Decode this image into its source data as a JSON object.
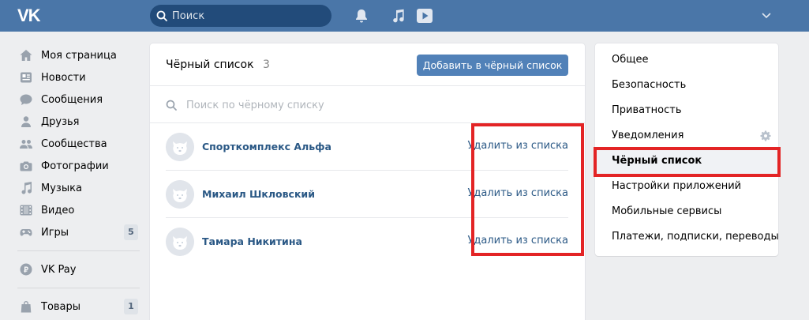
{
  "header": {
    "logo": "VK",
    "search_placeholder": "Поиск"
  },
  "left_menu": {
    "items": [
      {
        "label": "Моя страница",
        "icon": "home-icon"
      },
      {
        "label": "Новости",
        "icon": "news-icon"
      },
      {
        "label": "Сообщения",
        "icon": "messages-icon"
      },
      {
        "label": "Друзья",
        "icon": "friends-icon"
      },
      {
        "label": "Сообщества",
        "icon": "groups-icon"
      },
      {
        "label": "Фотографии",
        "icon": "camera-icon"
      },
      {
        "label": "Музыка",
        "icon": "music-icon"
      },
      {
        "label": "Видео",
        "icon": "video-icon"
      },
      {
        "label": "Игры",
        "icon": "gamepad-icon",
        "count": "5"
      }
    ],
    "pay": {
      "label": "VK Pay",
      "icon": "vkpay-icon"
    },
    "goods": {
      "label": "Товары",
      "icon": "bag-icon",
      "count": "1"
    }
  },
  "blacklist": {
    "title": "Чёрный список",
    "count": "3",
    "add_button": "Добавить в чёрный список",
    "search_placeholder": "Поиск по чёрному списку",
    "remove_label": "Удалить из списка",
    "rows": [
      {
        "name": "Спорткомплекс Альфа"
      },
      {
        "name": "Михаил Шкловский"
      },
      {
        "name": "Тамара Никитина"
      }
    ]
  },
  "settings_menu": {
    "items": [
      {
        "label": "Общее"
      },
      {
        "label": "Безопасность"
      },
      {
        "label": "Приватность"
      },
      {
        "label": "Уведомления"
      },
      {
        "label": "Чёрный список"
      },
      {
        "label": "Настройки приложений"
      },
      {
        "label": "Мобильные сервисы"
      },
      {
        "label": "Платежи, подписки, переводы"
      }
    ]
  },
  "colors": {
    "header_bg": "#4a76a8",
    "link": "#2a5885",
    "button": "#5181b8",
    "highlight_box": "#e32425",
    "page_bg": "#edeef0"
  }
}
